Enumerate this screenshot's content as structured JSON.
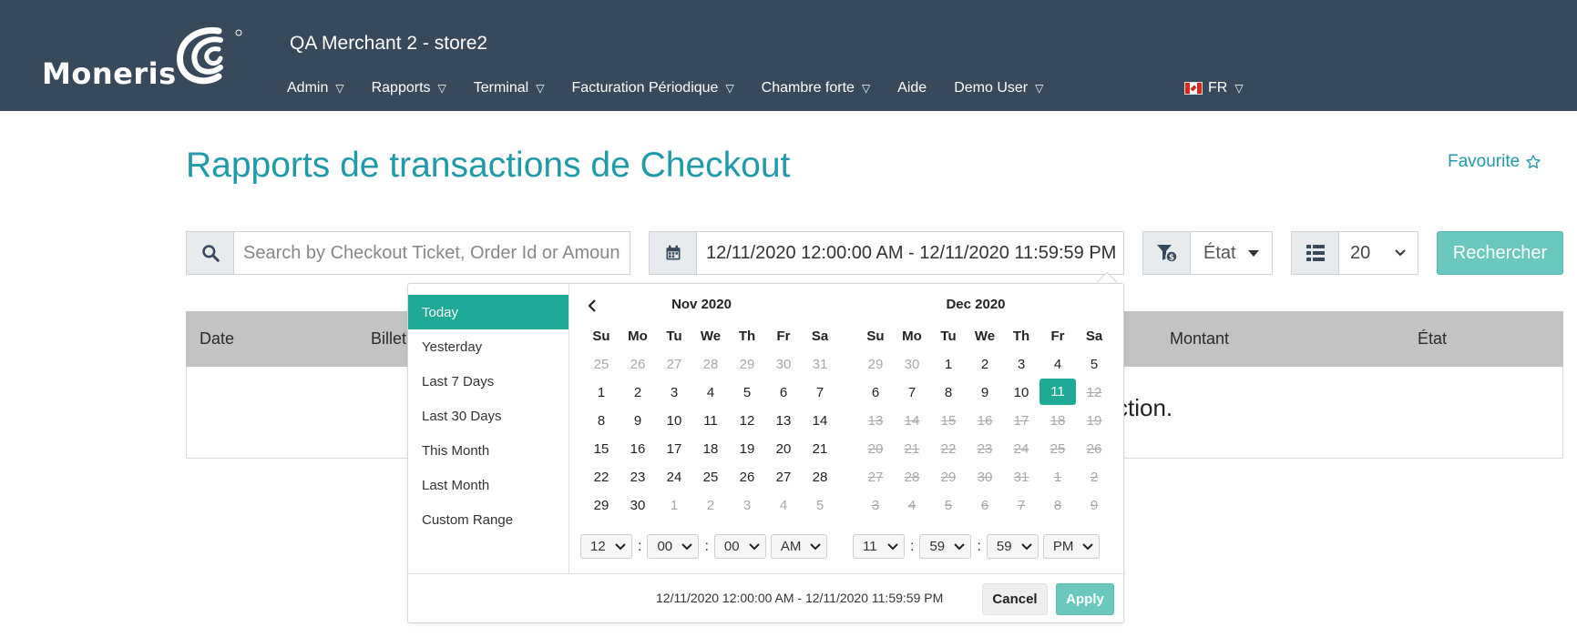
{
  "header": {
    "logo_text": "Moneris",
    "merchant": "QA Merchant 2 - store2",
    "nav": [
      {
        "label": "Admin",
        "has_menu": true
      },
      {
        "label": "Rapports",
        "has_menu": true
      },
      {
        "label": "Terminal",
        "has_menu": true
      },
      {
        "label": "Facturation Périodique",
        "has_menu": true
      },
      {
        "label": "Chambre forte",
        "has_menu": true
      },
      {
        "label": "Aide",
        "has_menu": false
      },
      {
        "label": "Demo User",
        "has_menu": true
      }
    ],
    "language": "FR"
  },
  "page": {
    "title": "Rapports de transactions de Checkout",
    "favourite_label": "Favourite"
  },
  "toolbar": {
    "search_placeholder": "Search by Checkout Ticket, Order Id or Amount",
    "date_range": "12/11/2020 12:00:00 AM - 12/11/2020 11:59:59 PM",
    "state_label": "État",
    "page_size": "20",
    "search_button": "Rechercher"
  },
  "table": {
    "columns": [
      "Date",
      "Billet",
      "Montant",
      "État"
    ],
    "empty_message_visible": "ction."
  },
  "picker": {
    "ranges": [
      "Today",
      "Yesterday",
      "Last 7 Days",
      "Last 30 Days",
      "This Month",
      "Last Month",
      "Custom Range"
    ],
    "active_range": "Today",
    "weekdays": [
      "Su",
      "Mo",
      "Tu",
      "We",
      "Th",
      "Fr",
      "Sa"
    ],
    "left_month": {
      "title": "Nov 2020",
      "days": [
        {
          "d": "25",
          "s": "off"
        },
        {
          "d": "26",
          "s": "off"
        },
        {
          "d": "27",
          "s": "off"
        },
        {
          "d": "28",
          "s": "off"
        },
        {
          "d": "29",
          "s": "off"
        },
        {
          "d": "30",
          "s": "off"
        },
        {
          "d": "31",
          "s": "off"
        },
        {
          "d": "1",
          "s": ""
        },
        {
          "d": "2",
          "s": ""
        },
        {
          "d": "3",
          "s": ""
        },
        {
          "d": "4",
          "s": ""
        },
        {
          "d": "5",
          "s": ""
        },
        {
          "d": "6",
          "s": ""
        },
        {
          "d": "7",
          "s": ""
        },
        {
          "d": "8",
          "s": ""
        },
        {
          "d": "9",
          "s": ""
        },
        {
          "d": "10",
          "s": ""
        },
        {
          "d": "11",
          "s": ""
        },
        {
          "d": "12",
          "s": ""
        },
        {
          "d": "13",
          "s": ""
        },
        {
          "d": "14",
          "s": ""
        },
        {
          "d": "15",
          "s": ""
        },
        {
          "d": "16",
          "s": ""
        },
        {
          "d": "17",
          "s": ""
        },
        {
          "d": "18",
          "s": ""
        },
        {
          "d": "19",
          "s": ""
        },
        {
          "d": "20",
          "s": ""
        },
        {
          "d": "21",
          "s": ""
        },
        {
          "d": "22",
          "s": ""
        },
        {
          "d": "23",
          "s": ""
        },
        {
          "d": "24",
          "s": ""
        },
        {
          "d": "25",
          "s": ""
        },
        {
          "d": "26",
          "s": ""
        },
        {
          "d": "27",
          "s": ""
        },
        {
          "d": "28",
          "s": ""
        },
        {
          "d": "29",
          "s": ""
        },
        {
          "d": "30",
          "s": ""
        },
        {
          "d": "1",
          "s": "off"
        },
        {
          "d": "2",
          "s": "off"
        },
        {
          "d": "3",
          "s": "off"
        },
        {
          "d": "4",
          "s": "off"
        },
        {
          "d": "5",
          "s": "off"
        }
      ]
    },
    "right_month": {
      "title": "Dec 2020",
      "days": [
        {
          "d": "29",
          "s": "off"
        },
        {
          "d": "30",
          "s": "off"
        },
        {
          "d": "1",
          "s": ""
        },
        {
          "d": "2",
          "s": ""
        },
        {
          "d": "3",
          "s": ""
        },
        {
          "d": "4",
          "s": ""
        },
        {
          "d": "5",
          "s": ""
        },
        {
          "d": "6",
          "s": ""
        },
        {
          "d": "7",
          "s": ""
        },
        {
          "d": "8",
          "s": ""
        },
        {
          "d": "9",
          "s": ""
        },
        {
          "d": "10",
          "s": ""
        },
        {
          "d": "11",
          "s": "sel"
        },
        {
          "d": "12",
          "s": "dis"
        },
        {
          "d": "13",
          "s": "dis"
        },
        {
          "d": "14",
          "s": "dis"
        },
        {
          "d": "15",
          "s": "dis"
        },
        {
          "d": "16",
          "s": "dis"
        },
        {
          "d": "17",
          "s": "dis"
        },
        {
          "d": "18",
          "s": "dis"
        },
        {
          "d": "19",
          "s": "dis"
        },
        {
          "d": "20",
          "s": "dis"
        },
        {
          "d": "21",
          "s": "dis"
        },
        {
          "d": "22",
          "s": "dis"
        },
        {
          "d": "23",
          "s": "dis"
        },
        {
          "d": "24",
          "s": "dis"
        },
        {
          "d": "25",
          "s": "dis"
        },
        {
          "d": "26",
          "s": "dis"
        },
        {
          "d": "27",
          "s": "dis"
        },
        {
          "d": "28",
          "s": "dis"
        },
        {
          "d": "29",
          "s": "dis"
        },
        {
          "d": "30",
          "s": "dis"
        },
        {
          "d": "31",
          "s": "dis"
        },
        {
          "d": "1",
          "s": "dis"
        },
        {
          "d": "2",
          "s": "dis"
        },
        {
          "d": "3",
          "s": "dis"
        },
        {
          "d": "4",
          "s": "dis"
        },
        {
          "d": "5",
          "s": "dis"
        },
        {
          "d": "6",
          "s": "dis"
        },
        {
          "d": "7",
          "s": "dis"
        },
        {
          "d": "8",
          "s": "dis"
        },
        {
          "d": "9",
          "s": "dis"
        }
      ]
    },
    "start_time": {
      "hour": "12",
      "minute": "00",
      "second": "00",
      "ampm": "AM"
    },
    "end_time": {
      "hour": "11",
      "minute": "59",
      "second": "59",
      "ampm": "PM"
    },
    "selected_range": "12/11/2020 12:00:00 AM - 12/11/2020 11:59:59 PM",
    "cancel_label": "Cancel",
    "apply_label": "Apply"
  },
  "colors": {
    "header_bg": "#37495b",
    "accent": "#1faa97",
    "title": "#1f9aa8",
    "button": "#6ac8bf"
  }
}
